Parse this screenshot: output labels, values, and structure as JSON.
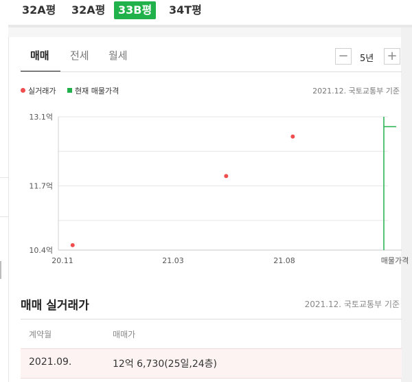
{
  "type_tabs": [
    {
      "label": "32A평",
      "active": false
    },
    {
      "label": "32A평",
      "active": false
    },
    {
      "label": "33B평",
      "active": true
    },
    {
      "label": "34T평",
      "active": false
    }
  ],
  "trade_tabs": [
    {
      "label": "매매",
      "active": true
    },
    {
      "label": "전세",
      "active": false
    },
    {
      "label": "월세",
      "active": false
    }
  ],
  "period": {
    "label": "5년",
    "minus_icon": "minus-icon",
    "plus_icon": "plus-icon"
  },
  "legend": {
    "actual_label": "실거래가",
    "listing_label": "현재 매물가격",
    "actual_color": "#f04e4e",
    "listing_color": "#20b14a"
  },
  "source_note": "2021.12. 국토교통부 기준",
  "chart_data": {
    "type": "scatter",
    "ylim": [
      10.4,
      13.1
    ],
    "y_ticks": [
      {
        "value": 13.1,
        "label": "13.1억"
      },
      {
        "value": 11.7,
        "label": "11.7억"
      },
      {
        "value": 10.4,
        "label": "10.4억"
      }
    ],
    "x_ticks": [
      "20.11",
      "21.03",
      "21.08",
      "매물가격"
    ],
    "series": [
      {
        "name": "실거래가",
        "color": "#f04e4e",
        "points": [
          {
            "x": "2020.11",
            "y": 10.5
          },
          {
            "x": "2021.06",
            "y": 11.9
          },
          {
            "x": "2021.09",
            "y": 12.7
          }
        ]
      },
      {
        "name": "현재 매물가격",
        "color": "#20b14a",
        "range": [
          10.4,
          13.1
        ],
        "value": 12.9
      }
    ]
  },
  "deals": {
    "title": "매매 실거래가",
    "source": "2021.12. 국토교통부 기준",
    "headers": [
      "계약월",
      "매매가"
    ],
    "rows": [
      {
        "month": "2021.09.",
        "price": "12억 6,730(25일,24층)"
      }
    ]
  }
}
